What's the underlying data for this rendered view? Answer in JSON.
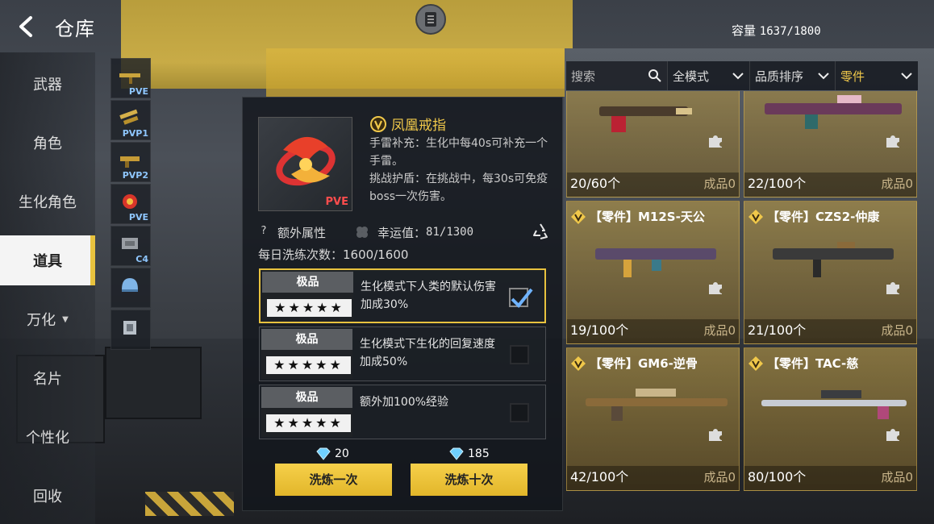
{
  "header": {
    "title": "仓库",
    "capacity_label": "容量",
    "capacity_value": "1637/1800"
  },
  "left_nav": {
    "items": [
      {
        "label": "武器"
      },
      {
        "label": "角色"
      },
      {
        "label": "生化角色"
      },
      {
        "label": "道具",
        "active": true
      },
      {
        "label": "万化"
      },
      {
        "label": "名片"
      },
      {
        "label": "个性化"
      },
      {
        "label": "回收"
      }
    ]
  },
  "sub_nav": {
    "items": [
      {
        "tag": "PVE"
      },
      {
        "tag": "PVP1"
      },
      {
        "tag": "PVP2"
      },
      {
        "tag": "PVE"
      },
      {
        "tag": "C4"
      },
      {
        "tag": ""
      },
      {
        "tag": ""
      }
    ]
  },
  "detail": {
    "badge": "PVE",
    "title": "凤凰戒指",
    "desc_lines": [
      "手雷补充：生化中每40s可补充一个手雷。",
      "挑战护盾：在挑战中，每30s可免疫boss一次伤害。"
    ],
    "extra_attr_label": "额外属性",
    "luck_label": "幸运值：",
    "luck_value": "81/1300",
    "wash_count_label": "每日洗练次数：",
    "wash_count_value": "1600/1600",
    "options": [
      {
        "grade": "极品",
        "stars": "★★★★★",
        "text": "生化模式下人类的默认伤害加成30%",
        "checked": true
      },
      {
        "grade": "极品",
        "stars": "★★★★★",
        "text": "生化模式下生化的回复速度加成50%",
        "checked": false
      },
      {
        "grade": "极品",
        "stars": "★★★★★",
        "text": "额外加100%经验",
        "checked": false
      }
    ],
    "cost_once": "20",
    "cost_ten": "185",
    "wash_once_label": "洗炼一次",
    "wash_ten_label": "洗炼十次"
  },
  "filters": {
    "search_placeholder": "搜索",
    "mode": "全模式",
    "sort": "品质排序",
    "category": "零件"
  },
  "cards": [
    {
      "name": "",
      "count": "20/60个",
      "crafted": "成品0"
    },
    {
      "name": "",
      "count": "22/100个",
      "crafted": "成品0"
    },
    {
      "name": "【零件】M12S-天公",
      "count": "19/100个",
      "crafted": "成品0"
    },
    {
      "name": "【零件】CZS2-仲康",
      "count": "21/100个",
      "crafted": "成品0"
    },
    {
      "name": "【零件】GM6-逆骨",
      "count": "42/100个",
      "crafted": "成品0"
    },
    {
      "name": "【零件】TAC-慈",
      "count": "80/100个",
      "crafted": "成品0"
    }
  ],
  "colors": {
    "accent_gold": "#e8c23e",
    "title_gold": "#f0c84a",
    "pve_red": "#ff4d4d"
  }
}
